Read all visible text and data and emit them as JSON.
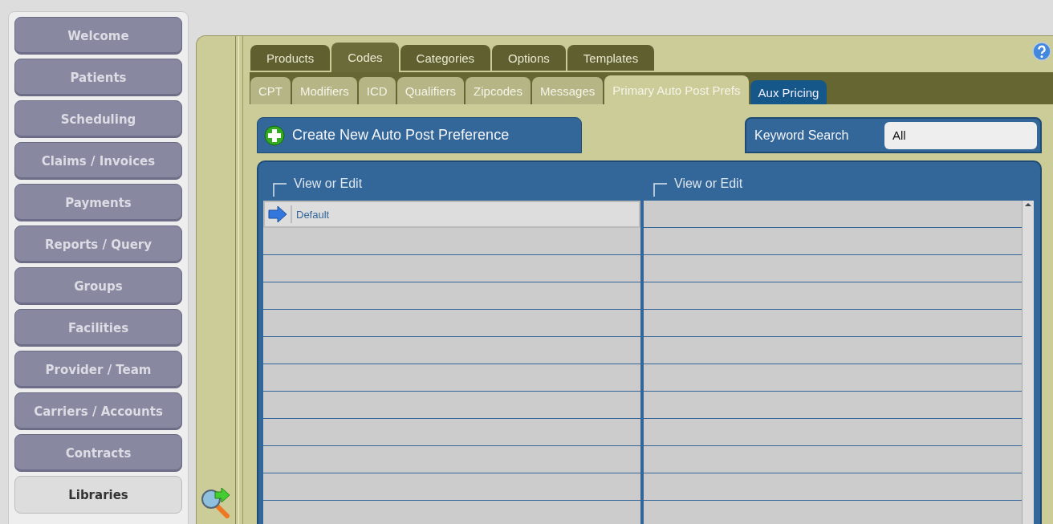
{
  "nav": [
    {
      "label": "Welcome",
      "selected": false
    },
    {
      "label": "Patients",
      "selected": false
    },
    {
      "label": "Scheduling",
      "selected": false
    },
    {
      "label": "Claims / Invoices",
      "selected": false
    },
    {
      "label": "Payments",
      "selected": false
    },
    {
      "label": "Reports / Query",
      "selected": false
    },
    {
      "label": "Groups",
      "selected": false
    },
    {
      "label": "Facilities",
      "selected": false
    },
    {
      "label": "Provider / Team",
      "selected": false
    },
    {
      "label": "Carriers / Accounts",
      "selected": false
    },
    {
      "label": "Contracts",
      "selected": false
    },
    {
      "label": "Libraries",
      "selected": true
    }
  ],
  "tabs": [
    {
      "label": "Products",
      "selected": false
    },
    {
      "label": "Codes",
      "selected": true
    },
    {
      "label": "Categories",
      "selected": false
    },
    {
      "label": "Options",
      "selected": false
    },
    {
      "label": "Templates",
      "selected": false
    }
  ],
  "subtabs": [
    {
      "label": "CPT",
      "selected": false,
      "kind": "plain"
    },
    {
      "label": "Modifiers",
      "selected": false,
      "kind": "plain"
    },
    {
      "label": "ICD",
      "selected": false,
      "kind": "plain"
    },
    {
      "label": "Qualifiers",
      "selected": false,
      "kind": "plain"
    },
    {
      "label": "Zipcodes",
      "selected": false,
      "kind": "plain"
    },
    {
      "label": "Messages",
      "selected": false,
      "kind": "plain"
    },
    {
      "label": "Primary Auto Post Prefs",
      "selected": true,
      "kind": "plain"
    },
    {
      "label": "Aux Pricing",
      "selected": false,
      "kind": "accent"
    }
  ],
  "create_button": {
    "label": "Create New Auto Post Preference"
  },
  "keyword_search": {
    "label": "Keyword Search",
    "value": "All"
  },
  "grid": {
    "columns": [
      "View or Edit",
      "View or Edit"
    ],
    "rows": [
      {
        "name": "Default"
      }
    ]
  }
}
